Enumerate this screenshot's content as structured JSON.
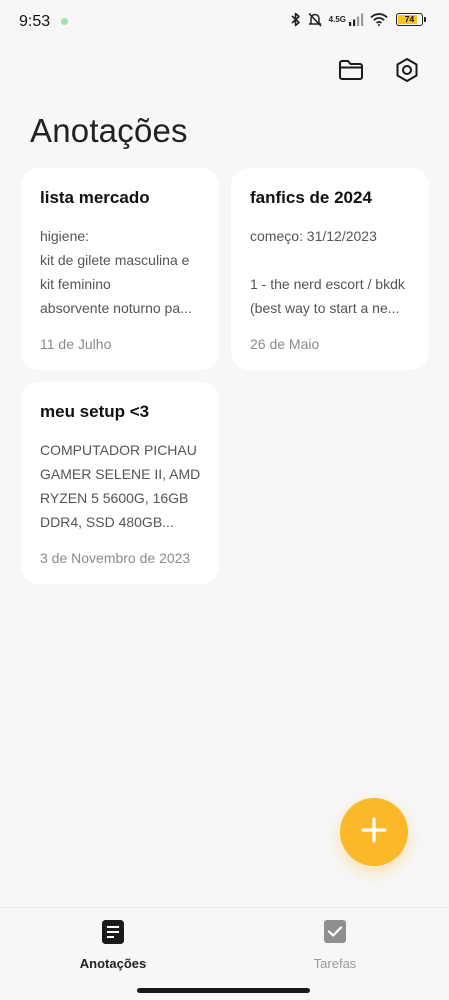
{
  "status_bar": {
    "time": "9:53",
    "network": "4.5G",
    "battery": "74"
  },
  "header": {
    "title": "Anotações"
  },
  "notes": [
    {
      "title": "lista mercado",
      "lines": [
        "higiene:",
        "kit de gilete masculina e",
        "kit feminino",
        "absorvente noturno pa..."
      ],
      "date": "11 de Julho"
    },
    {
      "title": "fanfics de 2024",
      "lines": [
        "começo: 31/12/2023",
        "",
        "1 - the nerd escort / bkdk",
        "(best way to start a ne..."
      ],
      "date": "26 de Maio"
    },
    {
      "title": "meu setup <3",
      "lines": [
        "COMPUTADOR PICHAU",
        "GAMER SELENE II, AMD",
        "RYZEN 5 5600G, 16GB",
        "DDR4, SSD 480GB..."
      ],
      "date": "3 de Novembro de 2023"
    }
  ],
  "bottom_nav": {
    "notes_label": "Anotações",
    "tasks_label": "Tarefas"
  },
  "colors": {
    "accent": "#fbb829",
    "background": "#f7f7f7",
    "card": "#ffffff"
  },
  "icons": {
    "folder": "folder-icon",
    "settings": "settings-icon",
    "add": "plus-icon",
    "notes": "note-icon",
    "tasks": "checkbox-icon"
  }
}
